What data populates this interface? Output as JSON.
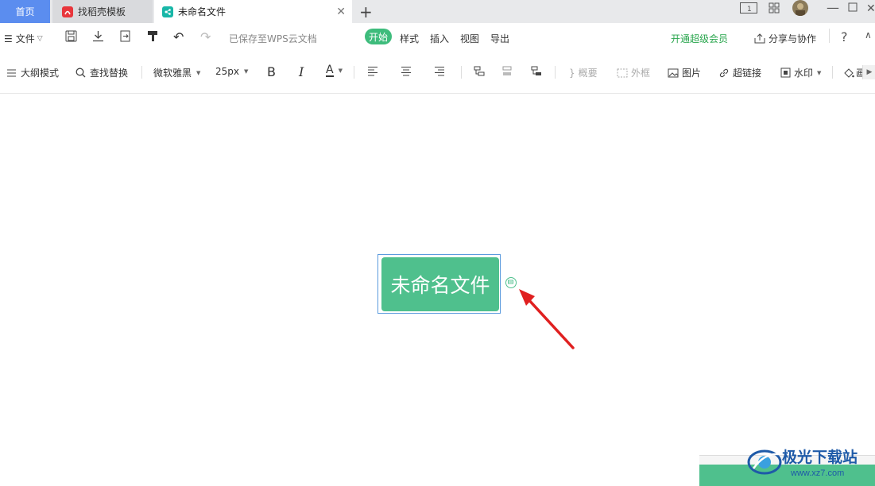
{
  "tabs": {
    "home": "首页",
    "template": "找稻壳模板",
    "doc": "未命名文件"
  },
  "menubar": {
    "file": "文件",
    "saved_status": "已保存至WPS云文档",
    "start": "开始",
    "style": "样式",
    "insert": "插入",
    "view": "视图",
    "export": "导出",
    "vip": "开通超级会员",
    "share": "分享与协作",
    "help": "?"
  },
  "toolbar": {
    "outline_mode": "大纲模式",
    "find_replace": "查找替换",
    "font": "微软雅黑",
    "size": "25px",
    "bold": "B",
    "italic": "I",
    "font_color": "A",
    "summary": "概要",
    "frame": "外框",
    "image": "图片",
    "hyperlink": "超链接",
    "watermark": "水印",
    "more": "画"
  },
  "canvas": {
    "root_node": "未命名文件"
  },
  "watermark": {
    "text": "极光下载站",
    "url": "www.xz7.com"
  },
  "colors": {
    "accent": "#4fc08d",
    "tab_blue": "#5b8def",
    "arrow_red": "#e02020"
  }
}
